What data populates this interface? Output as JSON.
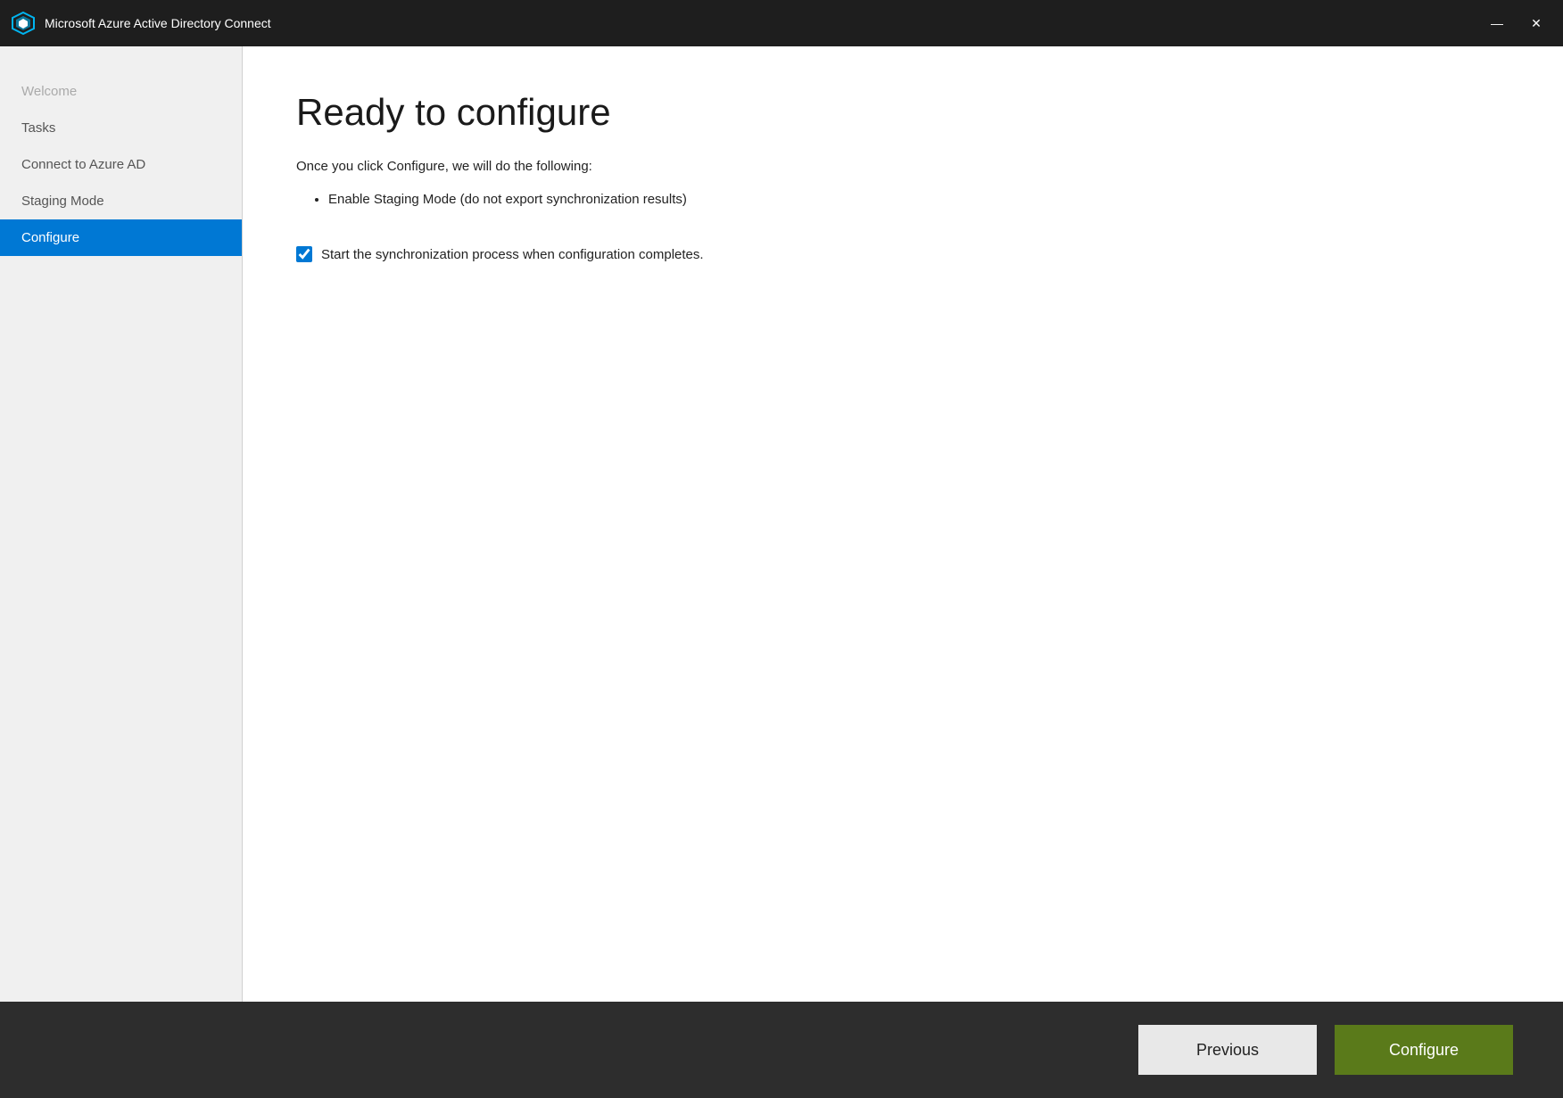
{
  "window": {
    "title": "Microsoft Azure Active Directory Connect"
  },
  "titlebar": {
    "minimize_label": "—",
    "close_label": "✕"
  },
  "sidebar": {
    "items": [
      {
        "id": "welcome",
        "label": "Welcome",
        "state": "disabled"
      },
      {
        "id": "tasks",
        "label": "Tasks",
        "state": "normal"
      },
      {
        "id": "connect-azure-ad",
        "label": "Connect to Azure AD",
        "state": "normal"
      },
      {
        "id": "staging-mode",
        "label": "Staging Mode",
        "state": "normal"
      },
      {
        "id": "configure",
        "label": "Configure",
        "state": "active"
      }
    ]
  },
  "content": {
    "page_title": "Ready to configure",
    "description": "Once you click Configure, we will do the following:",
    "bullet_items": [
      "Enable Staging Mode (do not export synchronization results)"
    ],
    "checkbox": {
      "label": "Start the synchronization process when configuration completes.",
      "checked": true
    }
  },
  "footer": {
    "previous_label": "Previous",
    "configure_label": "Configure"
  }
}
